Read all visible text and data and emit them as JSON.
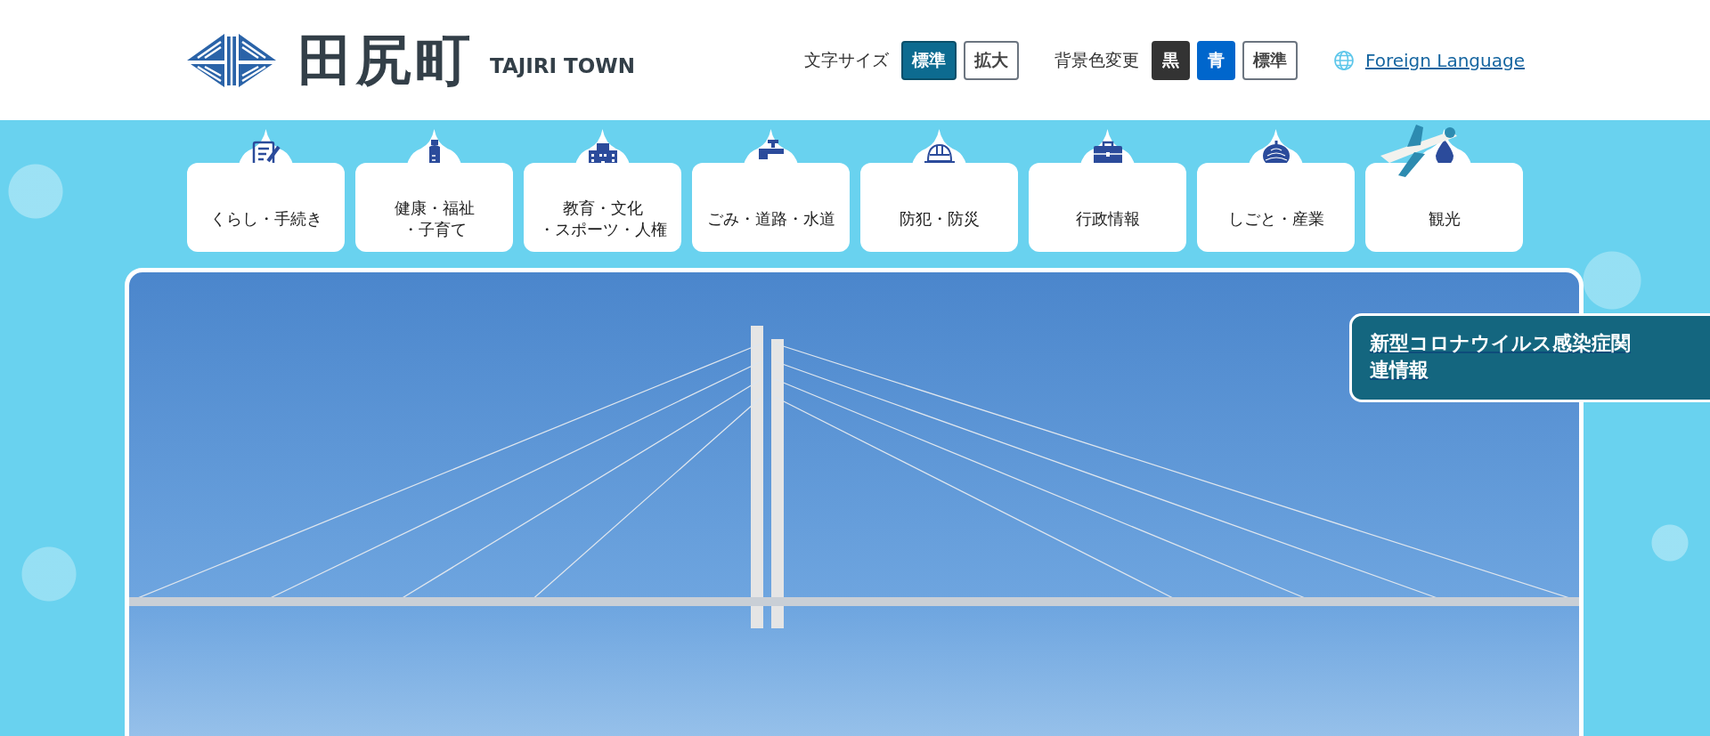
{
  "header": {
    "logo_kanji": "田尻町",
    "logo_latin": "TAJIRI TOWN"
  },
  "text_size": {
    "label": "文字サイズ",
    "options": [
      {
        "label": "標準",
        "selected": true
      },
      {
        "label": "拡大",
        "selected": false
      }
    ]
  },
  "background_color": {
    "label": "背景色変更",
    "options": [
      {
        "label": "黒",
        "kind": "black"
      },
      {
        "label": "青",
        "kind": "blue"
      },
      {
        "label": "標準",
        "kind": "plain"
      }
    ]
  },
  "foreign_language": {
    "label": "Foreign Language"
  },
  "nav": [
    {
      "lines": [
        "くらし・手続き"
      ]
    },
    {
      "lines": [
        "健康・福祉",
        "・子育て"
      ]
    },
    {
      "lines": [
        "教育・文化",
        "・スポーツ・人権"
      ]
    },
    {
      "lines": [
        "ごみ・道路・水道"
      ]
    },
    {
      "lines": [
        "防犯・防災"
      ]
    },
    {
      "lines": [
        "行政情報"
      ]
    },
    {
      "lines": [
        "しごと・産業"
      ]
    },
    {
      "lines": [
        "観光"
      ]
    }
  ],
  "banner": {
    "label": "新型コロナウイルス感染症関連情報"
  }
}
